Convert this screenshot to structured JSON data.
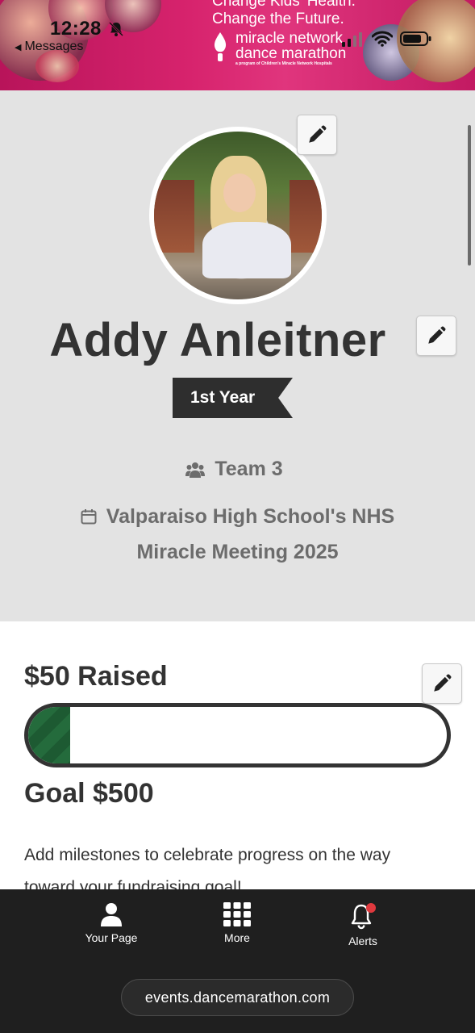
{
  "status_bar": {
    "time": "12:28",
    "back_label": "Messages"
  },
  "banner": {
    "tagline_line1": "Change Kids' Health.",
    "tagline_line2": "Change the Future.",
    "brand_line1": "miracle network",
    "brand_line2": "dance marathon",
    "brand_sub": "a program of Children's Miracle Network Hospitals"
  },
  "profile": {
    "name": "Addy Anleitner",
    "year_badge": "1st Year",
    "team": "Team 3",
    "event_line1": "Valparaiso High School's NHS",
    "event_line2": "Miracle Meeting 2025"
  },
  "fundraising": {
    "raised_label": "$50 Raised",
    "goal_label": "Goal $500",
    "progress_fraction": 0.1,
    "progress_color": "#1d5a32",
    "milestones_text": "Add milestones to celebrate progress on the way toward your fundraising goal!"
  },
  "nav": {
    "your_page": "Your Page",
    "more": "More",
    "alerts": "Alerts",
    "alert_dot_color": "#e0393e"
  },
  "browser": {
    "url": "events.dancemarathon.com"
  },
  "colors": {
    "banner": "#d7236d",
    "profile_bg": "#e3e3e3",
    "nav_bg": "#1f1f1f",
    "text_dark": "#333333"
  }
}
